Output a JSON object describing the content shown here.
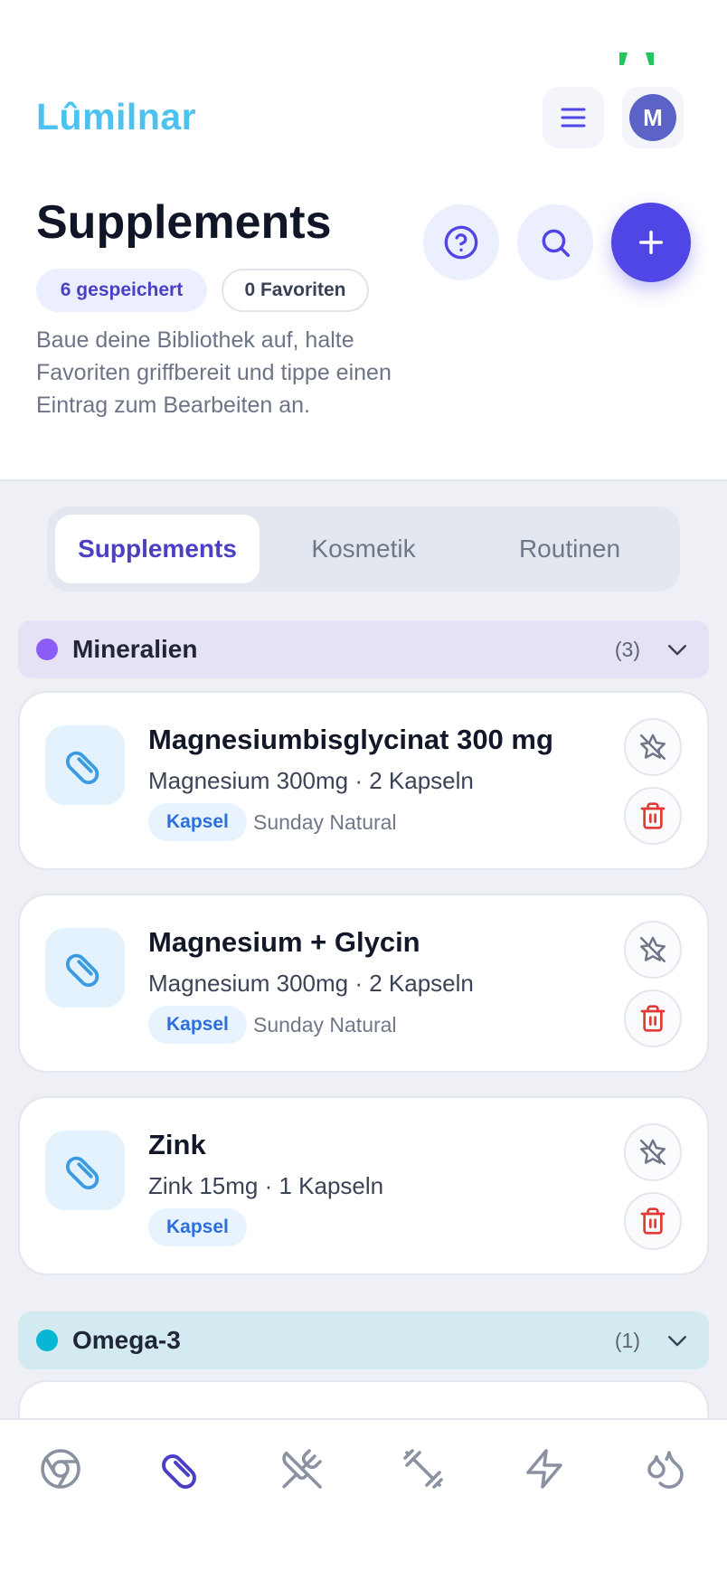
{
  "app": {
    "brand": "Lûmilnar",
    "avatar_initial": "M"
  },
  "header": {
    "title": "Supplements",
    "saved_badge": "6 gespeichert",
    "favorites_badge": "0 Favoriten",
    "description": "Baue deine Bibliothek auf, halte Favoriten griffbereit und tippe einen Eintrag zum Bearbeiten an."
  },
  "tabs": [
    {
      "label": "Supplements",
      "active": true
    },
    {
      "label": "Kosmetik",
      "active": false
    },
    {
      "label": "Routinen",
      "active": false
    }
  ],
  "groups": [
    {
      "name": "Mineralien",
      "count": "(3)",
      "color": "#8b5cf6",
      "bg": "#e5e2f5"
    },
    {
      "name": "Omega-3",
      "count": "(1)",
      "color": "#06b6d4",
      "bg": "#d3ebf0"
    }
  ],
  "items": [
    {
      "name": "Magnesiumbisglycinat 300 mg",
      "dose": "Magnesium 300mg · 2 Kapseln",
      "form": "Kapsel",
      "brand": "Sunday Natural"
    },
    {
      "name": "Magnesium + Glycin",
      "dose": "Magnesium 300mg · 2 Kapseln",
      "form": "Kapsel",
      "brand": "Sunday Natural"
    },
    {
      "name": "Zink",
      "dose": "Zink 15mg · 1 Kapseln",
      "form": "Kapsel",
      "brand": ""
    }
  ],
  "nav": [
    {
      "icon": "chrome-icon",
      "active": false
    },
    {
      "icon": "pill-icon",
      "active": true
    },
    {
      "icon": "utensils-crossed-icon",
      "active": false
    },
    {
      "icon": "dumbbell-icon",
      "active": false
    },
    {
      "icon": "zap-icon",
      "active": false
    },
    {
      "icon": "droplets-icon",
      "active": false
    }
  ],
  "colors": {
    "accent": "#4f46e5",
    "brand": "#4cc2f0",
    "danger": "#e53935",
    "pill": "#3b9be0"
  }
}
